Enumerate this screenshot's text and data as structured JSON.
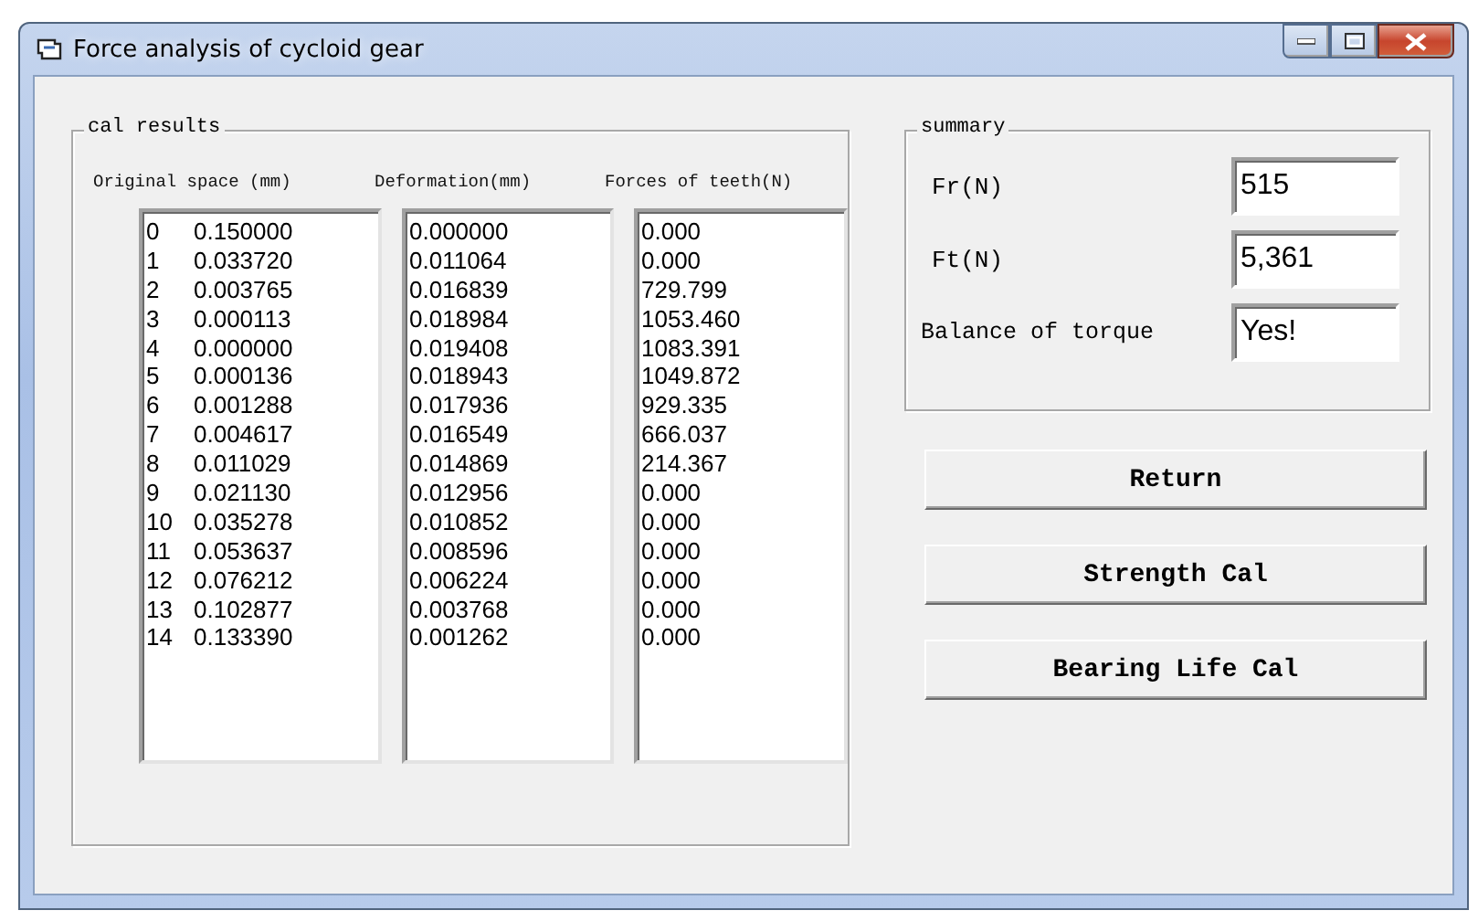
{
  "window": {
    "title": "Force analysis of cycloid gear"
  },
  "cal_results": {
    "title": "cal results",
    "original_space": {
      "heading": "Original space (mm)",
      "rows": [
        {
          "index": "0",
          "value": "0.150000"
        },
        {
          "index": "1",
          "value": "0.033720"
        },
        {
          "index": "2",
          "value": "0.003765"
        },
        {
          "index": "3",
          "value": "0.000113"
        },
        {
          "index": "4",
          "value": "0.000000"
        },
        {
          "index": "5",
          "value": "0.000136"
        },
        {
          "index": "6",
          "value": "0.001288"
        },
        {
          "index": "7",
          "value": "0.004617"
        },
        {
          "index": "8",
          "value": "0.011029"
        },
        {
          "index": "9",
          "value": "0.021130"
        },
        {
          "index": "10",
          "value": "0.035278"
        },
        {
          "index": "11",
          "value": "0.053637"
        },
        {
          "index": "12",
          "value": "0.076212"
        },
        {
          "index": "13",
          "value": "0.102877"
        },
        {
          "index": "14",
          "value": "0.133390"
        }
      ]
    },
    "deformation": {
      "heading": "Deformation(mm)",
      "items": [
        "0.000000",
        "0.011064",
        "0.016839",
        "0.018984",
        "0.019408",
        "0.018943",
        "0.017936",
        "0.016549",
        "0.014869",
        "0.012956",
        "0.010852",
        "0.008596",
        "0.006224",
        "0.003768",
        "0.001262"
      ]
    },
    "forces": {
      "heading": "Forces of teeth(N)",
      "items": [
        "0.000",
        "0.000",
        "729.799",
        "1053.460",
        "1083.391",
        "1049.872",
        "929.335",
        "666.037",
        "214.367",
        "0.000",
        "0.000",
        "0.000",
        "0.000",
        "0.000",
        "0.000"
      ]
    }
  },
  "summary": {
    "title": "summary",
    "fields": [
      {
        "label": "Fr(N)",
        "value": "515"
      },
      {
        "label": "Ft(N)",
        "value": "5,361"
      },
      {
        "label": "Balance of torque",
        "value": "Yes!"
      }
    ]
  },
  "buttons": [
    "Return",
    "Strength Cal",
    "Bearing Life Cal"
  ]
}
